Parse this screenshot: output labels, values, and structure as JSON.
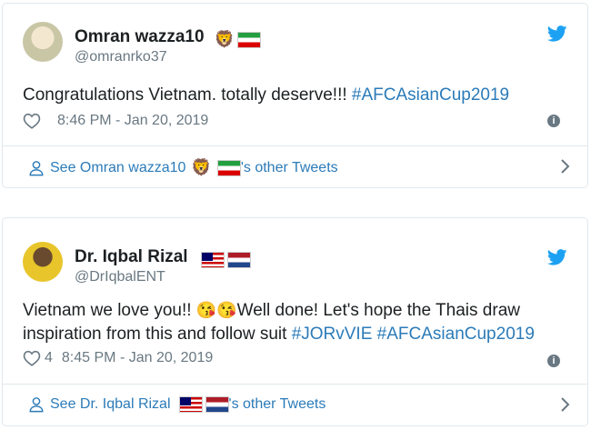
{
  "tweets": [
    {
      "name": "Omran wazza10",
      "name_emoji": "🦁",
      "handle": "@omranrko37",
      "text_plain": "Congratulations Vietnam. totally deserve!!! ",
      "hashtag": "#AFCAsianCup2019",
      "likes": "",
      "timestamp": "8:46 PM - Jan 20, 2019",
      "footer_prefix": "See Omran wazza10",
      "footer_suffix": "'s other Tweets",
      "flags": [
        "iran"
      ]
    },
    {
      "name": "Dr. Iqbal Rizal",
      "handle": "@DrIqbalENT",
      "text_part1": "Vietnam we love you!! ",
      "kiss_emoji": "😘😘",
      "text_part2": "Well done! Let's hope the Thais draw inspiration from this and follow suit ",
      "hashtag1": "#JORvVIE",
      "hashtag2": "#AFCAsianCup2019",
      "likes": "4",
      "timestamp": "8:45 PM - Jan 20, 2019",
      "footer_prefix": "See Dr. Iqbal Rizal",
      "footer_suffix": "'s other Tweets",
      "flags": [
        "malaysia",
        "netherlands"
      ]
    }
  ],
  "colors": {
    "link": "#2b7bb9",
    "muted": "#697882",
    "border": "#e1e8ed",
    "twitter_blue": "#1da1f2"
  },
  "icons": [
    "twitter-bird-icon",
    "heart-icon",
    "info-icon",
    "person-icon",
    "chevron-right-icon",
    "lion-emoji",
    "kiss-emoji"
  ]
}
